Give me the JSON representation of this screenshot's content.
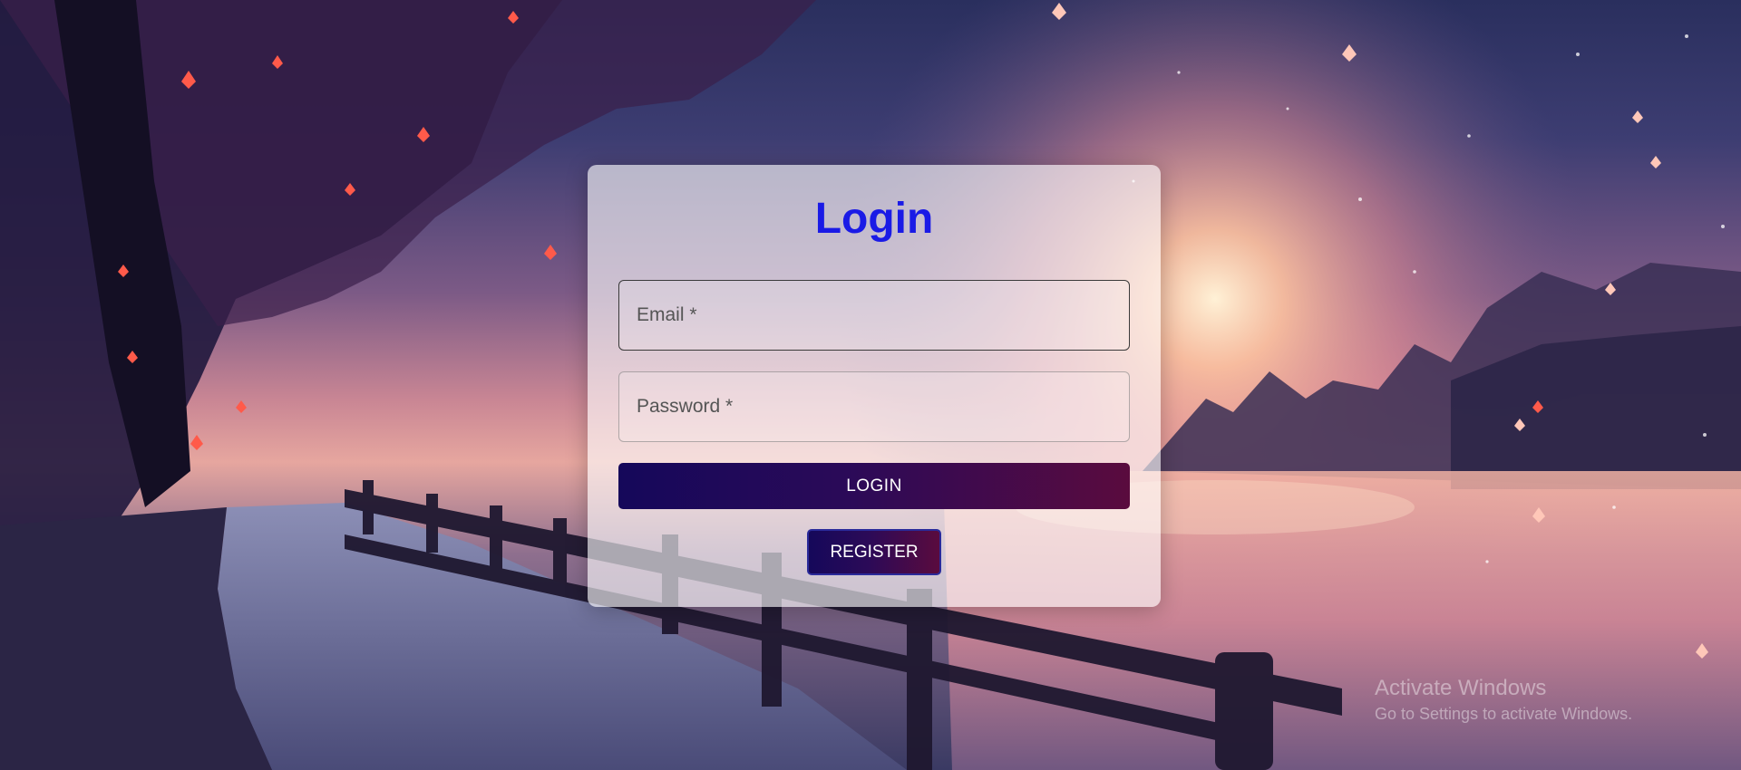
{
  "login": {
    "title": "Login",
    "email": {
      "placeholder": "Email *",
      "value": ""
    },
    "password": {
      "placeholder": "Password *",
      "value": ""
    },
    "login_button": "LOGIN",
    "register_button": "REGISTER"
  },
  "background": {
    "scene": "sunset-riverside-path-with-autumn-tree",
    "accent_colors": [
      "#2a2f5e",
      "#c98694",
      "#e6a69f"
    ]
  },
  "os_watermark": {
    "title": "Activate Windows",
    "subtitle": "Go to Settings to activate Windows."
  },
  "colors": {
    "title": "#1a1ae6",
    "button_gradient_start": "#15085a",
    "button_gradient_end": "#5a0b3e"
  }
}
